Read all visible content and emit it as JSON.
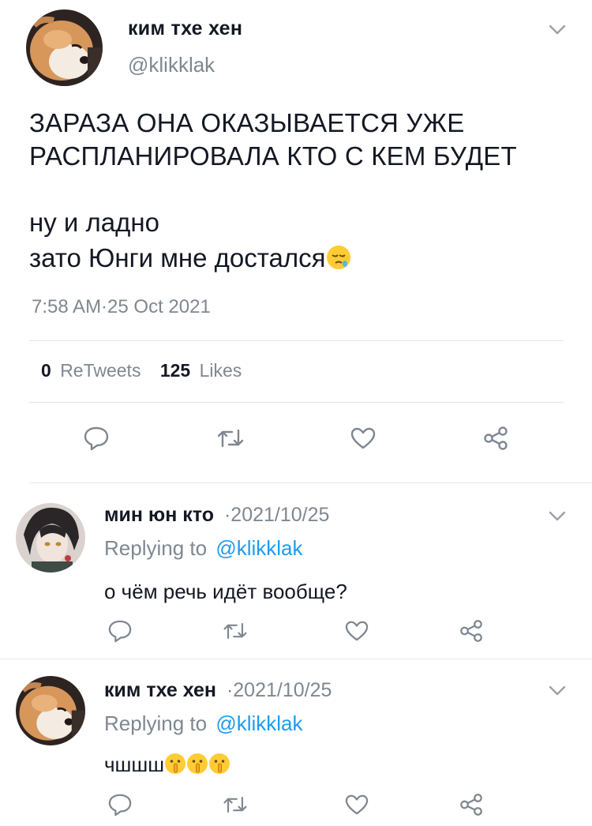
{
  "main_tweet": {
    "display_name": "ким тхе хен",
    "handle": "@klikklak",
    "text_line1": "ЗАРАЗА ОНА ОКАЗЫВАЕТСЯ УЖЕ",
    "text_line2": "РАСПЛАНИРОВАЛА КТО С КЕМ БУДЕТ",
    "text_line3": "ну и ладно",
    "text_line4": "зато Юнги мне достался",
    "text_line4_emoji": "sleepy-face-emoji",
    "timestamp": "7:58 AM·25 Oct 2021",
    "retweets_count": "0",
    "retweets_label": "ReTweets",
    "likes_count": "125",
    "likes_label": "Likes"
  },
  "replies": [
    {
      "display_name": "мин юн кто",
      "date": "·2021/10/25",
      "replying_prefix": "Replying to",
      "replying_handle": "@klikklak",
      "text": "о чём речь идёт вообще?"
    },
    {
      "display_name": "ким тхе хен",
      "date": "·2021/10/25",
      "replying_prefix": "Replying to",
      "replying_handle": "@klikklak",
      "text": "чшшш",
      "emojis": [
        "shushing-face-emoji",
        "shushing-face-emoji",
        "shushing-face-emoji"
      ]
    }
  ],
  "icons": {
    "reply": "reply-bubble-icon",
    "retweet": "retweet-icon",
    "like": "heart-icon",
    "share": "share-icon",
    "menu": "chevron-down-icon"
  },
  "colors": {
    "text": "#141823",
    "muted": "#7f8790",
    "link": "#1d9bf0",
    "divider": "#e3e6ea"
  }
}
